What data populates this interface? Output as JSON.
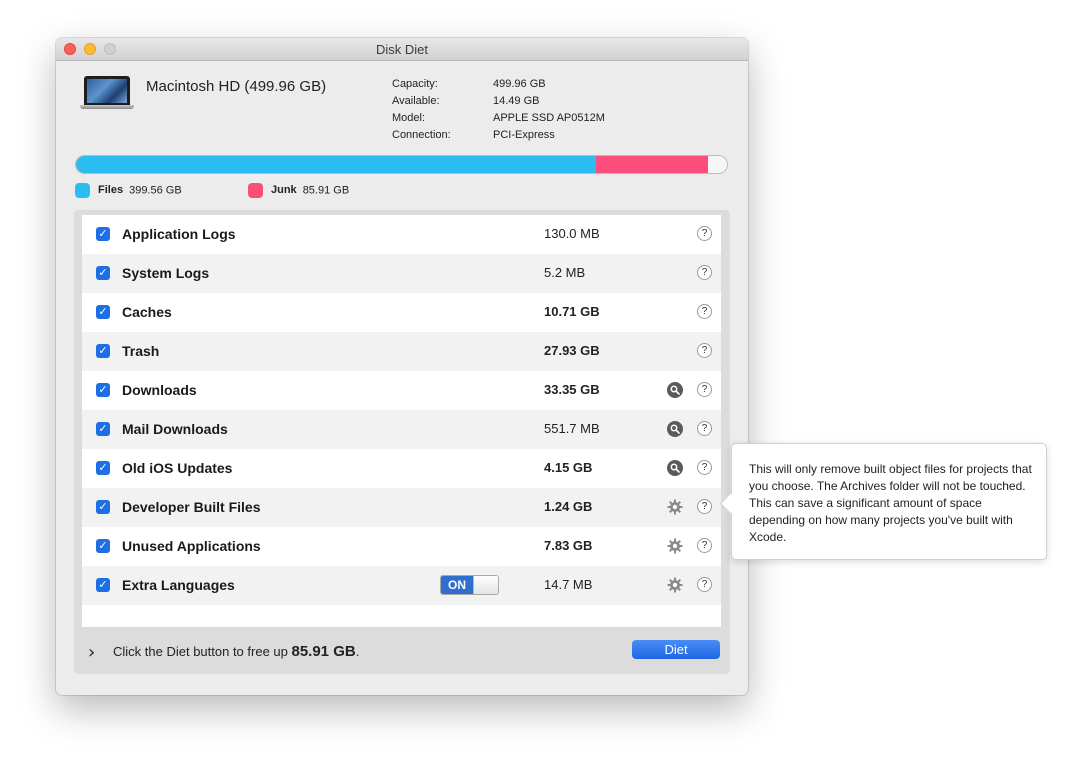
{
  "window": {
    "title": "Disk Diet"
  },
  "disk": {
    "name": "Macintosh HD (499.96 GB)",
    "info": [
      {
        "label": "Capacity:",
        "value": "499.96 GB"
      },
      {
        "label": "Available:",
        "value": "14.49 GB"
      },
      {
        "label": "Model:",
        "value": "APPLE SSD AP0512M"
      },
      {
        "label": "Connection:",
        "value": "PCI-Express"
      }
    ]
  },
  "usage": {
    "files": {
      "label": "Files",
      "value": "399.56 GB",
      "fraction": 0.7992,
      "color": "#2bbcf1"
    },
    "junk": {
      "label": "Junk",
      "value": "85.91 GB",
      "fraction": 0.1718,
      "color": "#fb4e7a"
    }
  },
  "items": [
    {
      "label": "Application Logs",
      "size": "130.0 MB",
      "bold_size": false,
      "checked": true,
      "action": "none"
    },
    {
      "label": "System Logs",
      "size": "5.2 MB",
      "bold_size": false,
      "checked": true,
      "action": "none"
    },
    {
      "label": "Caches",
      "size": "10.71 GB",
      "bold_size": true,
      "checked": true,
      "action": "none"
    },
    {
      "label": "Trash",
      "size": "27.93 GB",
      "bold_size": true,
      "checked": true,
      "action": "none"
    },
    {
      "label": "Downloads",
      "size": "33.35 GB",
      "bold_size": true,
      "checked": true,
      "action": "search-icon"
    },
    {
      "label": "Mail Downloads",
      "size": "551.7 MB",
      "bold_size": false,
      "checked": true,
      "action": "search-icon"
    },
    {
      "label": "Old iOS Updates",
      "size": "4.15 GB",
      "bold_size": true,
      "checked": true,
      "action": "search-icon"
    },
    {
      "label": "Developer Built Files",
      "size": "1.24 GB",
      "bold_size": true,
      "checked": true,
      "action": "gear-icon"
    },
    {
      "label": "Unused Applications",
      "size": "7.83 GB",
      "bold_size": true,
      "checked": true,
      "action": "gear-icon"
    },
    {
      "label": "Extra Languages",
      "size": "14.7 MB",
      "bold_size": false,
      "checked": true,
      "action": "gear-icon",
      "toggle": "ON"
    }
  ],
  "help_symbol": "?",
  "checkbox_glyph": "✓",
  "footer": {
    "chevron": "›",
    "text_before": "Click the Diet button to free up ",
    "amount": "85.91 GB",
    "text_after": ".",
    "diet_button": "Diet"
  },
  "tooltip": {
    "text": "This will only remove built object files for projects that you choose. The Archives folder will not be touched. This can save a significant amount of space depending on how many projects you've built with Xcode."
  }
}
